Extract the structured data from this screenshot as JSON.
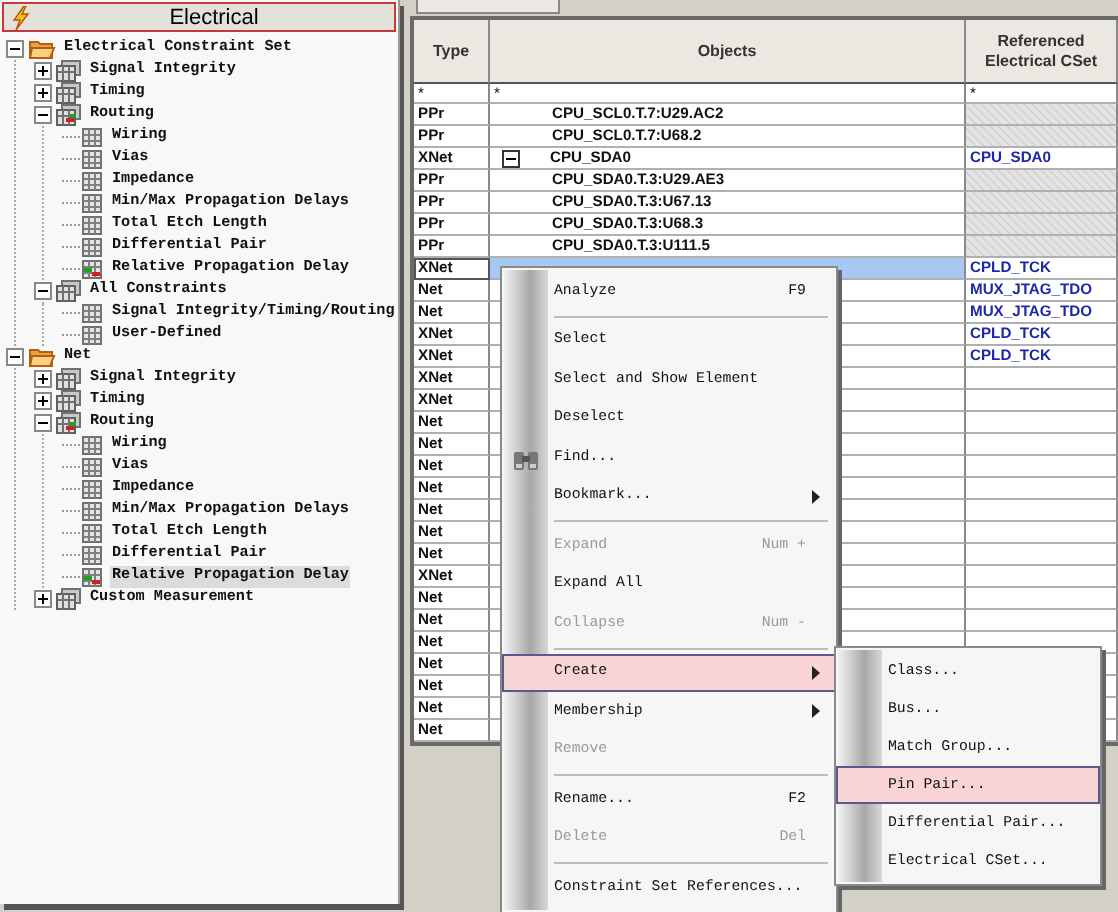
{
  "panel": {
    "title": "Electrical"
  },
  "tree": [
    {
      "label": "Electrical Constraint Set",
      "kind": "set",
      "expanded": true,
      "selected": false,
      "children": [
        {
          "label": "Signal Integrity",
          "kind": "group",
          "expanded": false,
          "selected": false
        },
        {
          "label": "Timing",
          "kind": "group",
          "expanded": false,
          "selected": false
        },
        {
          "label": "Routing",
          "kind": "group-marked",
          "expanded": true,
          "selected": false,
          "children": [
            {
              "label": "Wiring",
              "kind": "leaf",
              "selected": false
            },
            {
              "label": "Vias",
              "kind": "leaf",
              "selected": false
            },
            {
              "label": "Impedance",
              "kind": "leaf",
              "selected": false
            },
            {
              "label": "Min/Max Propagation Delays",
              "kind": "leaf",
              "selected": false
            },
            {
              "label": "Total Etch Length",
              "kind": "leaf",
              "selected": false
            },
            {
              "label": "Differential Pair",
              "kind": "leaf",
              "selected": false
            },
            {
              "label": "Relative Propagation Delay",
              "kind": "leaf-marked",
              "selected": false
            }
          ]
        },
        {
          "label": "All Constraints",
          "kind": "group",
          "expanded": true,
          "selected": false,
          "children": [
            {
              "label": "Signal Integrity/Timing/Routing",
              "kind": "leaf",
              "selected": false
            },
            {
              "label": "User-Defined",
              "kind": "leaf",
              "selected": false
            }
          ]
        }
      ]
    },
    {
      "label": "Net",
      "kind": "set",
      "expanded": true,
      "selected": false,
      "children": [
        {
          "label": "Signal Integrity",
          "kind": "group",
          "expanded": false,
          "selected": false
        },
        {
          "label": "Timing",
          "kind": "group",
          "expanded": false,
          "selected": false
        },
        {
          "label": "Routing",
          "kind": "group-marked",
          "expanded": true,
          "selected": false,
          "children": [
            {
              "label": "Wiring",
              "kind": "leaf",
              "selected": false
            },
            {
              "label": "Vias",
              "kind": "leaf",
              "selected": false
            },
            {
              "label": "Impedance",
              "kind": "leaf",
              "selected": false
            },
            {
              "label": "Min/Max Propagation Delays",
              "kind": "leaf",
              "selected": false
            },
            {
              "label": "Total Etch Length",
              "kind": "leaf",
              "selected": false
            },
            {
              "label": "Differential Pair",
              "kind": "leaf",
              "selected": false
            },
            {
              "label": "Relative Propagation Delay",
              "kind": "leaf-marked",
              "selected": true
            }
          ]
        },
        {
          "label": "Custom Measurement",
          "kind": "group",
          "expanded": false,
          "selected": false
        }
      ]
    }
  ],
  "grid": {
    "columns": [
      "Type",
      "Objects",
      "Referenced Electrical CSet"
    ],
    "filters": [
      "*",
      "*",
      "*"
    ],
    "rows": [
      {
        "type": "PPr",
        "kind": "pin-pair",
        "object": "CPU_SCL0.T.7:U29.AC2",
        "selected": false
      },
      {
        "type": "PPr",
        "kind": "pin-pair",
        "object": "CPU_SCL0.T.7:U68.2",
        "selected": false
      },
      {
        "type": "XNet",
        "kind": "net",
        "object": "CPU_SDA0",
        "expanded": true,
        "ref": "CPU_SDA0",
        "selected": false
      },
      {
        "type": "PPr",
        "kind": "pin-pair",
        "object": "CPU_SDA0.T.3:U29.AE3",
        "selected": false
      },
      {
        "type": "PPr",
        "kind": "pin-pair",
        "object": "CPU_SDA0.T.3:U67.13",
        "selected": false
      },
      {
        "type": "PPr",
        "kind": "pin-pair",
        "object": "CPU_SDA0.T.3:U68.3",
        "selected": false
      },
      {
        "type": "PPr",
        "kind": "pin-pair",
        "object": "CPU_SDA0.T.3:U111.5",
        "selected": false
      },
      {
        "type": "XNet",
        "kind": "net",
        "ref": "CPLD_TCK",
        "selected": true
      },
      {
        "type": "Net",
        "kind": "net",
        "ref": "MUX_JTAG_TDO",
        "selected": false
      },
      {
        "type": "Net",
        "kind": "net",
        "ref": "MUX_JTAG_TDO",
        "selected": false
      },
      {
        "type": "XNet",
        "kind": "net",
        "ref": "CPLD_TCK",
        "selected": false
      },
      {
        "type": "XNet",
        "kind": "net",
        "ref": "CPLD_TCK",
        "selected": false
      },
      {
        "type": "XNet",
        "kind": "net",
        "selected": false
      },
      {
        "type": "XNet",
        "kind": "net",
        "selected": false
      },
      {
        "type": "Net",
        "kind": "net",
        "selected": false
      },
      {
        "type": "Net",
        "kind": "net",
        "selected": false
      },
      {
        "type": "Net",
        "kind": "net",
        "selected": false
      },
      {
        "type": "Net",
        "kind": "net",
        "selected": false
      },
      {
        "type": "Net",
        "kind": "net",
        "selected": false
      },
      {
        "type": "Net",
        "kind": "net",
        "selected": false
      },
      {
        "type": "Net",
        "kind": "net",
        "selected": false
      },
      {
        "type": "XNet",
        "kind": "net",
        "selected": false
      },
      {
        "type": "Net",
        "kind": "net",
        "selected": false
      },
      {
        "type": "Net",
        "kind": "net",
        "selected": false
      },
      {
        "type": "Net",
        "kind": "net",
        "selected": false
      },
      {
        "type": "Net",
        "kind": "net",
        "selected": false
      },
      {
        "type": "Net",
        "kind": "net",
        "selected": false
      },
      {
        "type": "Net",
        "kind": "net",
        "selected": false
      },
      {
        "type": "Net",
        "kind": "net",
        "selected": false
      }
    ]
  },
  "context_menu": {
    "items": [
      {
        "kind": "item",
        "label": "Analyze",
        "shortcut": "F9",
        "disabled": false,
        "submenu": false,
        "selected": false
      },
      {
        "kind": "separator"
      },
      {
        "kind": "item",
        "label": "Select",
        "disabled": false,
        "submenu": false,
        "selected": false
      },
      {
        "kind": "item",
        "label": "Select and Show Element",
        "disabled": false,
        "submenu": false,
        "selected": false
      },
      {
        "kind": "item",
        "label": "Deselect",
        "disabled": false,
        "submenu": false,
        "selected": false
      },
      {
        "kind": "item",
        "label": "Find...",
        "icon": true,
        "disabled": false,
        "submenu": false,
        "selected": false
      },
      {
        "kind": "item",
        "label": "Bookmark...",
        "disabled": false,
        "submenu": true,
        "selected": false
      },
      {
        "kind": "separator"
      },
      {
        "kind": "item",
        "label": "Expand",
        "shortcut": "Num +",
        "disabled": true,
        "submenu": false,
        "selected": false
      },
      {
        "kind": "item",
        "label": "Expand All",
        "disabled": false,
        "submenu": false,
        "selected": false
      },
      {
        "kind": "item",
        "label": "Collapse",
        "shortcut": "Num -",
        "disabled": true,
        "submenu": false,
        "selected": false
      },
      {
        "kind": "separator"
      },
      {
        "kind": "item",
        "label": "Create",
        "disabled": false,
        "submenu": true,
        "selected": true
      },
      {
        "kind": "item",
        "label": "Membership",
        "disabled": false,
        "submenu": true,
        "selected": false
      },
      {
        "kind": "item",
        "label": "Remove",
        "disabled": true,
        "submenu": false,
        "selected": false
      },
      {
        "kind": "separator"
      },
      {
        "kind": "item",
        "label": "Rename...",
        "shortcut": "F2",
        "disabled": false,
        "submenu": false,
        "selected": false
      },
      {
        "kind": "item",
        "label": "Delete",
        "shortcut": "Del",
        "disabled": true,
        "submenu": false,
        "selected": false
      },
      {
        "kind": "separator"
      },
      {
        "kind": "item",
        "label": "Constraint Set References...",
        "disabled": false,
        "submenu": false,
        "selected": false
      }
    ]
  },
  "submenu": {
    "items": [
      {
        "label": "Class...",
        "selected": false
      },
      {
        "label": "Bus...",
        "selected": false
      },
      {
        "label": "Match Group...",
        "selected": false
      },
      {
        "label": "Pin Pair...",
        "selected": true
      },
      {
        "label": "Differential Pair...",
        "selected": false
      },
      {
        "label": "Electrical CSet...",
        "selected": false
      }
    ]
  }
}
